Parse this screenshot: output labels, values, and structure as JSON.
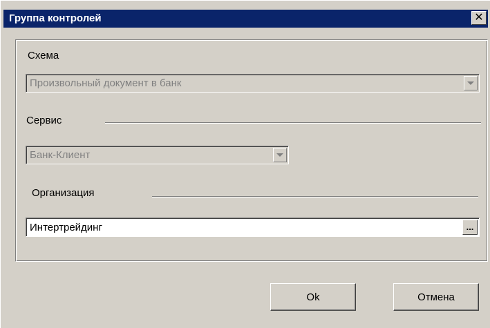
{
  "window": {
    "title": "Группа контролей",
    "close_glyph": "✕"
  },
  "schema": {
    "label": "Схема",
    "value": "Произвольный документ в банк"
  },
  "service": {
    "label": "Сервис",
    "value": "Банк-Клиент"
  },
  "organization": {
    "label": "Организация",
    "value": "Интертрейдинг",
    "browse_glyph": "..."
  },
  "buttons": {
    "ok_label": "Ok",
    "cancel_label": "Отмена"
  },
  "colors": {
    "titlebar": "#0a246a",
    "face": "#d4d0c8",
    "disabled_text": "#808080"
  },
  "icons": {
    "close": "close-icon",
    "dropdown": "chevron-down-icon",
    "browse": "ellipsis-icon"
  }
}
